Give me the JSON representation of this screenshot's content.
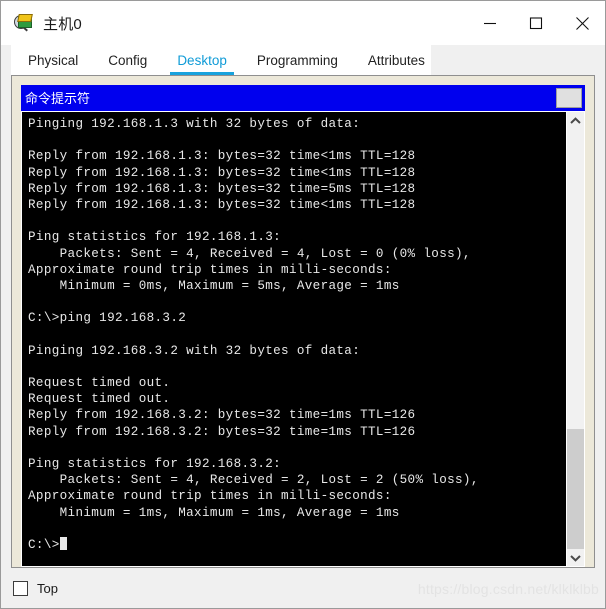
{
  "window": {
    "title": "主机0",
    "icon": "packet-tracer-host-icon",
    "controls": {
      "minimize": "minimize-icon",
      "maximize": "maximize-icon",
      "close": "close-icon"
    }
  },
  "tabs": [
    {
      "label": "Physical",
      "active": false
    },
    {
      "label": "Config",
      "active": false
    },
    {
      "label": "Desktop",
      "active": true
    },
    {
      "label": "Programming",
      "active": false
    },
    {
      "label": "Attributes",
      "active": false
    }
  ],
  "cmd_window": {
    "title": "命令提示符",
    "caption_color": "#0000ee",
    "restore_button": "restore-button"
  },
  "terminal": {
    "background": "#000000",
    "foreground": "#e8e8e8",
    "lines": [
      "Pinging 192.168.1.3 with 32 bytes of data:",
      "",
      "Reply from 192.168.1.3: bytes=32 time<1ms TTL=128",
      "Reply from 192.168.1.3: bytes=32 time<1ms TTL=128",
      "Reply from 192.168.1.3: bytes=32 time=5ms TTL=128",
      "Reply from 192.168.1.3: bytes=32 time<1ms TTL=128",
      "",
      "Ping statistics for 192.168.1.3:",
      "    Packets: Sent = 4, Received = 4, Lost = 0 (0% loss),",
      "Approximate round trip times in milli-seconds:",
      "    Minimum = 0ms, Maximum = 5ms, Average = 1ms",
      "",
      "C:\\>ping 192.168.3.2",
      "",
      "Pinging 192.168.3.2 with 32 bytes of data:",
      "",
      "Request timed out.",
      "Request timed out.",
      "Reply from 192.168.3.2: bytes=32 time=1ms TTL=126",
      "Reply from 192.168.3.2: bytes=32 time=1ms TTL=126",
      "",
      "Ping statistics for 192.168.3.2:",
      "    Packets: Sent = 4, Received = 2, Lost = 2 (50% loss),",
      "Approximate round trip times in milli-seconds:",
      "    Minimum = 1ms, Maximum = 1ms, Average = 1ms",
      ""
    ],
    "prompt": "C:\\>"
  },
  "scrollbar": {
    "up_arrow": "chevron-up-icon",
    "down_arrow": "chevron-down-icon",
    "position": "bottom"
  },
  "bottom": {
    "top_checkbox_label": "Top",
    "top_checkbox_checked": false,
    "watermark": "https://blog.csdn.net/klklklbb"
  }
}
